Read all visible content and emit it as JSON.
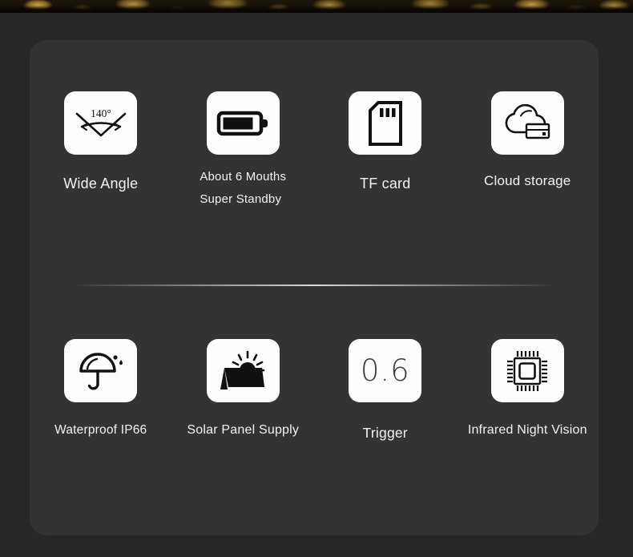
{
  "page": {
    "background_color": "#272727",
    "card_color": "#333333",
    "tile_color": "#fdfdfd",
    "label_color": "#f2f2f2",
    "icon_color": "#111111"
  },
  "photo_strip": {
    "name": "nature-foliage-photo-strip",
    "description": "cropped outdoor foliage photograph"
  },
  "divider": {
    "name": "section-divider"
  },
  "rows": [
    {
      "name": "feature-row-1",
      "features": [
        {
          "icon": "wide-angle-icon",
          "icon_text": "140°",
          "label": "Wide Angle",
          "label_line2": ""
        },
        {
          "icon": "battery-icon",
          "icon_text": "",
          "label": "About 6 Mouths",
          "label_line2": "Super Standby"
        },
        {
          "icon": "tf-card-icon",
          "icon_text": "",
          "label": "TF card",
          "label_line2": ""
        },
        {
          "icon": "cloud-storage-icon",
          "icon_text": "",
          "label": "Cloud storage",
          "label_line2": ""
        }
      ]
    },
    {
      "name": "feature-row-2",
      "features": [
        {
          "icon": "umbrella-waterproof-icon",
          "icon_text": "",
          "label": "Waterproof IP66",
          "label_line2": ""
        },
        {
          "icon": "solar-panel-icon",
          "icon_text": "",
          "label": "Solar Panel Supply",
          "label_line2": ""
        },
        {
          "icon": "trigger-speed-icon",
          "icon_text": "0.6",
          "label": "Trigger",
          "label_line2": ""
        },
        {
          "icon": "infrared-chip-icon",
          "icon_text": "",
          "label": "Infrared Night Vision",
          "label_line2": ""
        }
      ]
    }
  ]
}
